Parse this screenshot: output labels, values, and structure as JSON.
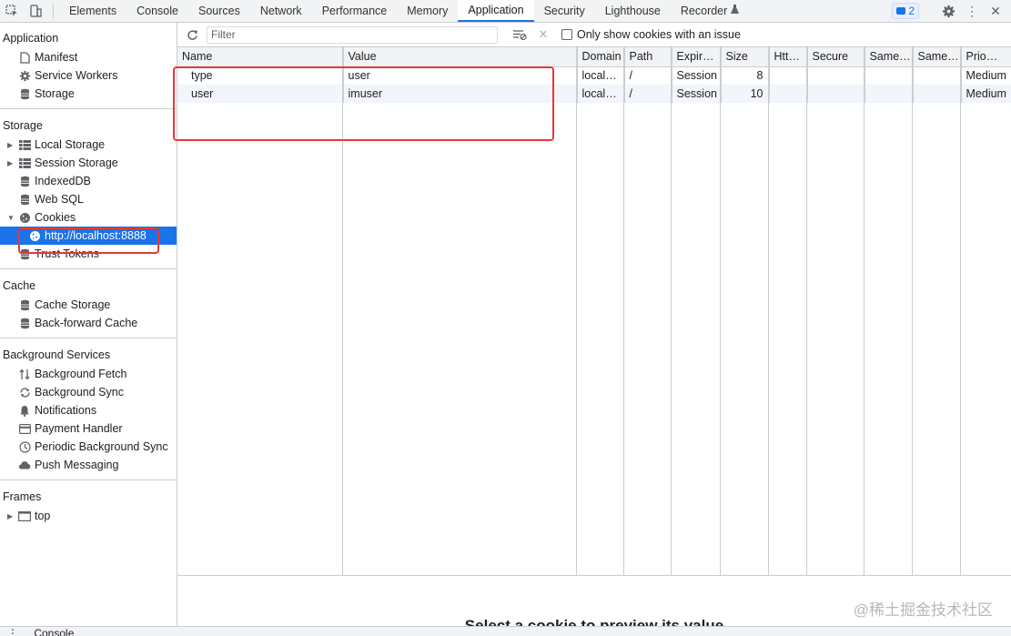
{
  "tabs": [
    "Elements",
    "Console",
    "Sources",
    "Network",
    "Performance",
    "Memory",
    "Application",
    "Security",
    "Lighthouse",
    "Recorder"
  ],
  "active_tab": "Application",
  "issues_count": "2",
  "sidebar": {
    "application": {
      "title": "Application",
      "items": [
        "Manifest",
        "Service Workers",
        "Storage"
      ]
    },
    "storage": {
      "title": "Storage",
      "items": [
        "Local Storage",
        "Session Storage",
        "IndexedDB",
        "Web SQL",
        "Cookies"
      ],
      "cookie_origin": "http://localhost:8888",
      "after": "Trust Tokens"
    },
    "cache": {
      "title": "Cache",
      "items": [
        "Cache Storage",
        "Back-forward Cache"
      ]
    },
    "background": {
      "title": "Background Services",
      "items": [
        "Background Fetch",
        "Background Sync",
        "Notifications",
        "Payment Handler",
        "Periodic Background Sync",
        "Push Messaging"
      ]
    },
    "frames": {
      "title": "Frames",
      "items": [
        "top"
      ]
    }
  },
  "toolbar": {
    "filter_placeholder": "Filter",
    "only_issues_label": "Only show cookies with an issue"
  },
  "table": {
    "headers": [
      "Name",
      "Value",
      "Domain",
      "Path",
      "Expir…",
      "Size",
      "Htt…",
      "Secure",
      "Same…",
      "Same…",
      "Prio…"
    ],
    "rows": [
      [
        "type",
        "user",
        "local…",
        "/",
        "Session",
        "8",
        "",
        "",
        "",
        "",
        "Medium"
      ],
      [
        "user",
        "imuser",
        "local…",
        "/",
        "Session",
        "10",
        "",
        "",
        "",
        "",
        "Medium"
      ]
    ]
  },
  "preview_text": "Select a cookie to preview its value",
  "watermark": "@稀土掘金技术社区",
  "drawer_label": "Console",
  "colors": {
    "accent": "#1a73e8",
    "highlight": "#e53935"
  }
}
